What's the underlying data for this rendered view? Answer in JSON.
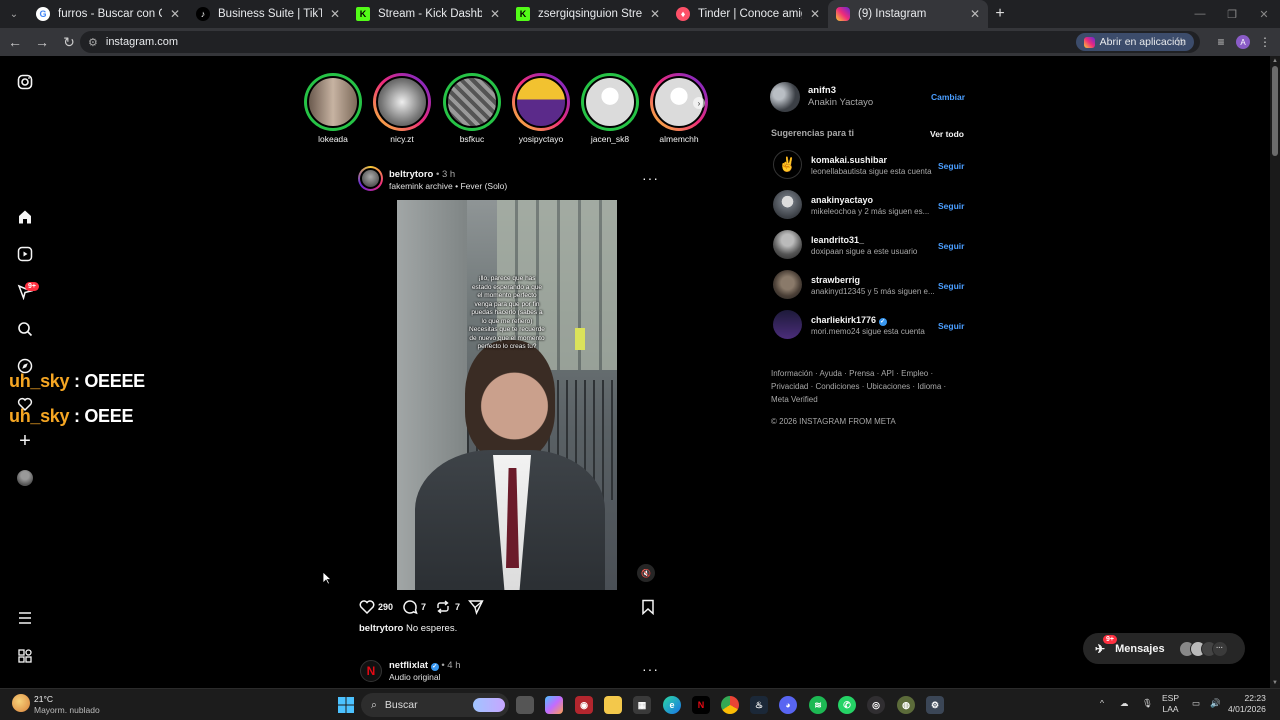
{
  "browser": {
    "tabs": [
      {
        "title": "furros - Buscar con Google",
        "icon": "google-icon",
        "color": "#ffffff"
      },
      {
        "title": "Business Suite | TikTok",
        "icon": "tiktok-icon",
        "color": "#000000"
      },
      {
        "title": "Stream - Kick Dashboard",
        "icon": "kick-icon",
        "color": "#53fc18"
      },
      {
        "title": "zsergiqsinguion Stream - Watch",
        "icon": "kick-icon",
        "color": "#53fc18"
      },
      {
        "title": "Tinder | Conoce amigos y gente",
        "icon": "tinder-icon",
        "color": "#fd5068"
      },
      {
        "title": "(9) Instagram",
        "icon": "instagram-icon",
        "color": "#e1306c"
      }
    ],
    "url": "instagram.com",
    "open_in_app": "Abrir en aplicación"
  },
  "overlay_chat": [
    {
      "user": "uh_sky",
      "message": ": OEEEE"
    },
    {
      "user": "uh_sky",
      "message": ": OEEE"
    }
  ],
  "sidebar": {
    "notifications_badge": "9+"
  },
  "stories": [
    {
      "name": "lokeada",
      "ring": "green"
    },
    {
      "name": "nicy.zt",
      "ring": "gradient"
    },
    {
      "name": "bsfkuc",
      "ring": "green"
    },
    {
      "name": "yosipyctayo",
      "ring": "gradient"
    },
    {
      "name": "jacen_sk8",
      "ring": "green"
    },
    {
      "name": "almemchh",
      "ring": "gradient"
    }
  ],
  "post": {
    "username": "beltrytoro",
    "time": "• 3 h",
    "audio": "fakemink archive • Fever (Solo)",
    "video_text": "¡llo, parece que has estado esperando a que el momento perfecto venga para que por fin puedas hacerlo (sabes a lo que me refiero) Necesitas que te recuerde de nuevo que el momento perfecto lo creas tu?",
    "likes": "290",
    "comments": "7",
    "reposts": "7",
    "caption_user": "beltrytoro",
    "caption_text": "No esperes."
  },
  "next_post": {
    "username": "netflixlat",
    "time": "• 4 h",
    "audio": "Audio original"
  },
  "right": {
    "me_username": "anifn3",
    "me_name": "Anakin Yactayo",
    "switch": "Cambiar",
    "suggestions_title": "Sugerencias para ti",
    "see_all": "Ver todo",
    "follow": "Seguir",
    "suggestions": [
      {
        "username": "komakai.sushibar",
        "sub": "leonellabautista sigue esta cuenta",
        "verified": false
      },
      {
        "username": "anakinyactayo",
        "sub": "mikeleochoa y 2 más siguen es...",
        "verified": false
      },
      {
        "username": "leandrito31_",
        "sub": "doxipaan sigue a este usuario",
        "verified": false
      },
      {
        "username": "strawberrig",
        "sub": "anakinyd12345 y 5 más siguen e...",
        "verified": false
      },
      {
        "username": "charliekirk1776",
        "sub": "mori.memo24 sigue esta cuenta",
        "verified": true
      }
    ],
    "footer_line1": "Información · Ayuda · Prensa · API · Empleo ·",
    "footer_line2": "Privacidad · Condiciones · Ubicaciones · Idioma ·",
    "footer_line3": "Meta Verified",
    "copyright": "© 2026 INSTAGRAM FROM META"
  },
  "messages": {
    "label": "Mensajes",
    "badge": "9+"
  },
  "taskbar": {
    "weather_temp": "21°C",
    "weather_desc": "Mayorm. nublado",
    "search": "Buscar",
    "lang1": "ESP",
    "lang2": "LAA",
    "time": "22:23",
    "date": "4/01/2026"
  }
}
